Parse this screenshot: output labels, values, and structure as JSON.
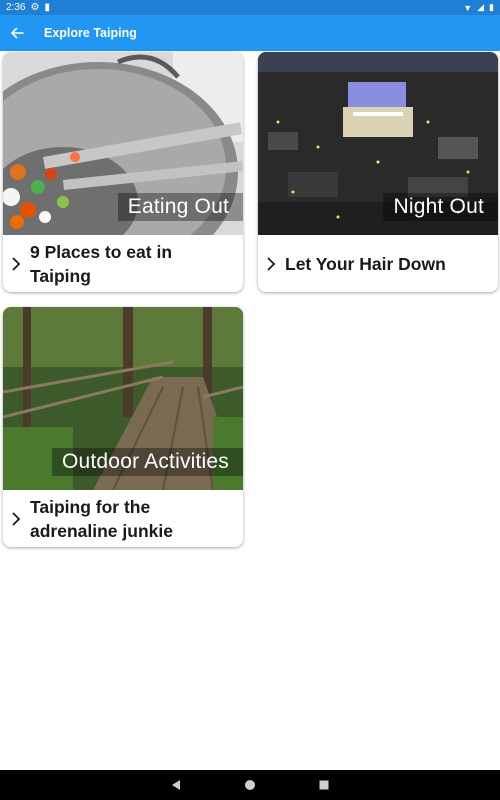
{
  "status_bar": {
    "time": "2:36"
  },
  "app_bar": {
    "title": "Explore Taiping"
  },
  "cards": [
    {
      "caption": "Eating Out",
      "title": "9 Places to eat in Taiping"
    },
    {
      "caption": "Night Out",
      "title": "Let Your Hair Down"
    },
    {
      "caption": "Outdoor Activities",
      "title": "Taiping for the adrenaline junkie"
    }
  ],
  "colors": {
    "status_bar": "#1f7fd6",
    "app_bar": "#2196f3",
    "nav_bar": "#000000"
  }
}
